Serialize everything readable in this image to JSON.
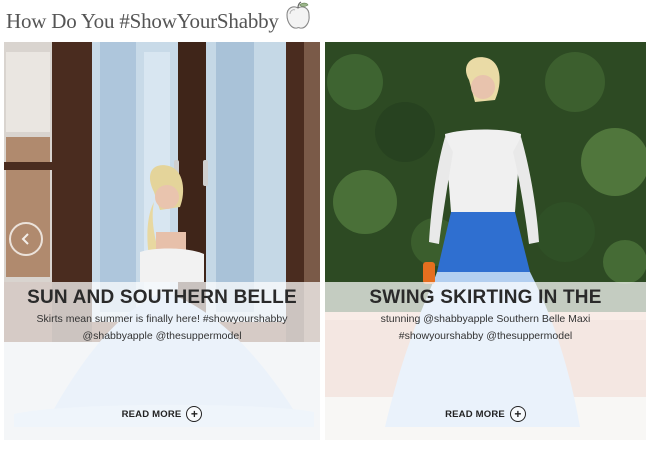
{
  "header": {
    "title": "How Do You #ShowYourShabby",
    "logo_icon": "apple-icon"
  },
  "posts": [
    {
      "title": "SUN AND SOUTHERN BELLE",
      "excerpt": "Skirts mean summer is finally here! #showyourshabby @shabbyapple @thesuppermodel",
      "read_more": "READ MORE"
    },
    {
      "title": "SWING SKIRTING IN THE",
      "excerpt": "stunning @shabbyapple Southern Belle Maxi #showyourshabby @thesuppermodel",
      "read_more": "READ MORE"
    }
  ],
  "carousel": {
    "prev_icon": "chevron-left-icon"
  },
  "colors": {
    "title_text": "#555555",
    "skirt_light": "#b9d3ef",
    "skirt_blue": "#2f6fd0",
    "door_wood": "#4a2c1f",
    "hedge": "#2d4a23"
  }
}
